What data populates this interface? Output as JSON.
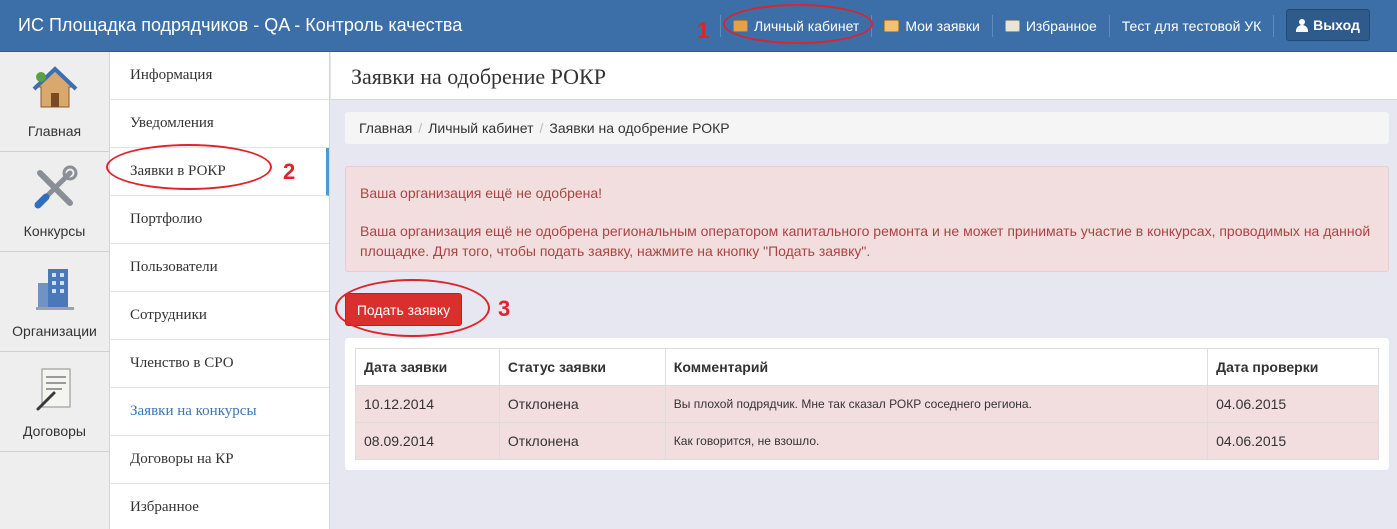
{
  "header": {
    "title": "ИС Площадка подрядчиков - QA - Контроль качества",
    "nav": [
      {
        "label": "Личный кабинет",
        "icon": "briefcase-icon"
      },
      {
        "label": "Мои заявки",
        "icon": "orders-icon"
      },
      {
        "label": "Избранное",
        "icon": "favorites-icon"
      },
      {
        "label": "Тест для тестовой УК",
        "icon": ""
      }
    ],
    "logout_label": "Выход"
  },
  "icon_sidebar": [
    {
      "label": "Главная",
      "icon": "home-icon"
    },
    {
      "label": "Конкурсы",
      "icon": "tools-icon"
    },
    {
      "label": "Организации",
      "icon": "building-icon"
    },
    {
      "label": "Договоры",
      "icon": "contract-icon"
    }
  ],
  "menu": [
    "Информация",
    "Уведомления",
    "Заявки в РОКР",
    "Портфолио",
    "Пользователи",
    "Сотрудники",
    "Членство в СРО",
    "Заявки на конкурсы",
    "Договоры на КР",
    "Избранное"
  ],
  "page": {
    "title": "Заявки на одобрение РОКР",
    "breadcrumb": [
      "Главная",
      "Личный кабинет",
      "Заявки на одобрение РОКР"
    ],
    "alert": {
      "title": "Ваша организация ещё не одобрена!",
      "line1": "Ваша организация ещё не одобрена региональным оператором капитального ремонта и не может принимать участие в конкурсах, проводимых на данной",
      "line2": "площадке. Для того, чтобы подать заявку, нажмите на кнопку \"Подать заявку\"."
    },
    "apply_button": "Подать заявку",
    "table": {
      "headers": [
        "Дата заявки",
        "Статус заявки",
        "Комментарий",
        "Дата проверки"
      ],
      "rows": [
        [
          "10.12.2014",
          "Отклонена",
          "Вы плохой подрядчик. Мне так сказал РОКР соседнего региона.",
          "04.06.2015"
        ],
        [
          "08.09.2014",
          "Отклонена",
          "Как говорится, не взошло.",
          "04.06.2015"
        ]
      ]
    }
  },
  "annotations": [
    "1",
    "2",
    "3"
  ],
  "colors": {
    "navbar": "#3c6ea8",
    "alert_bg": "#f2dede",
    "alert_text": "#a94442",
    "button": "#d9302e",
    "annotation": "#e0222a"
  }
}
